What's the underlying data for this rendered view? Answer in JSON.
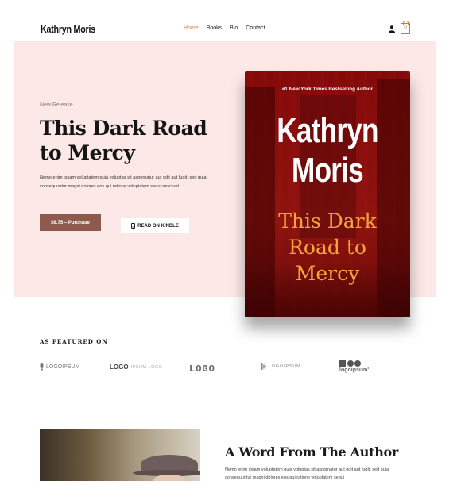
{
  "header": {
    "brand": "Kathryn Moris",
    "nav": [
      "Home",
      "Books",
      "Bio",
      "Contact"
    ],
    "active_nav": "Home",
    "cart_count": "0"
  },
  "hero": {
    "kicker": "New Release",
    "title": "This Dark Road to Mercy",
    "description": "Nemo enim ipsam voluptatem quia voluptas sit aspernatur aut odit aut fugit, sed quia consequuntur magni dolores eos qui ratione voluptatem sequi nesciunt.",
    "purchase_label": "$6.75 – Purchase",
    "kindle_label": "READ ON KINDLE",
    "background_color": "#fce8e6",
    "button_color": "#8d5b4c"
  },
  "book": {
    "tag": "#1 New York Times Bestselling Author",
    "author_line1": "Kathryn",
    "author_line2": "Moris",
    "title_line1": "This Dark",
    "title_line2": "Road to",
    "title_line3": "Mercy"
  },
  "featured": {
    "label": "AS FEATURED ON",
    "logos": {
      "logo1": "LOGOIPSUM",
      "logo2_a": "LOGO",
      "logo2_b": "IPSUM LOGO",
      "logo3": "LOGO",
      "logo4": "LOGOIPSUM",
      "logo5": "logoipsum'"
    }
  },
  "author_section": {
    "title": "A Word From The Author",
    "description": "Nemo enim ipsam voluptatem quia voluptas sit aspernatur aut odit aut fugit, sed quia consequuntur magni dolores eos qui ratione voluptatem sequi"
  },
  "icons": {
    "user": "user-icon",
    "cart": "cart-icon",
    "kindle": "kindle-icon"
  },
  "colors": {
    "accent": "#e07b39",
    "cover_red": "#8c0a0a",
    "cover_title": "#f4a23a"
  }
}
